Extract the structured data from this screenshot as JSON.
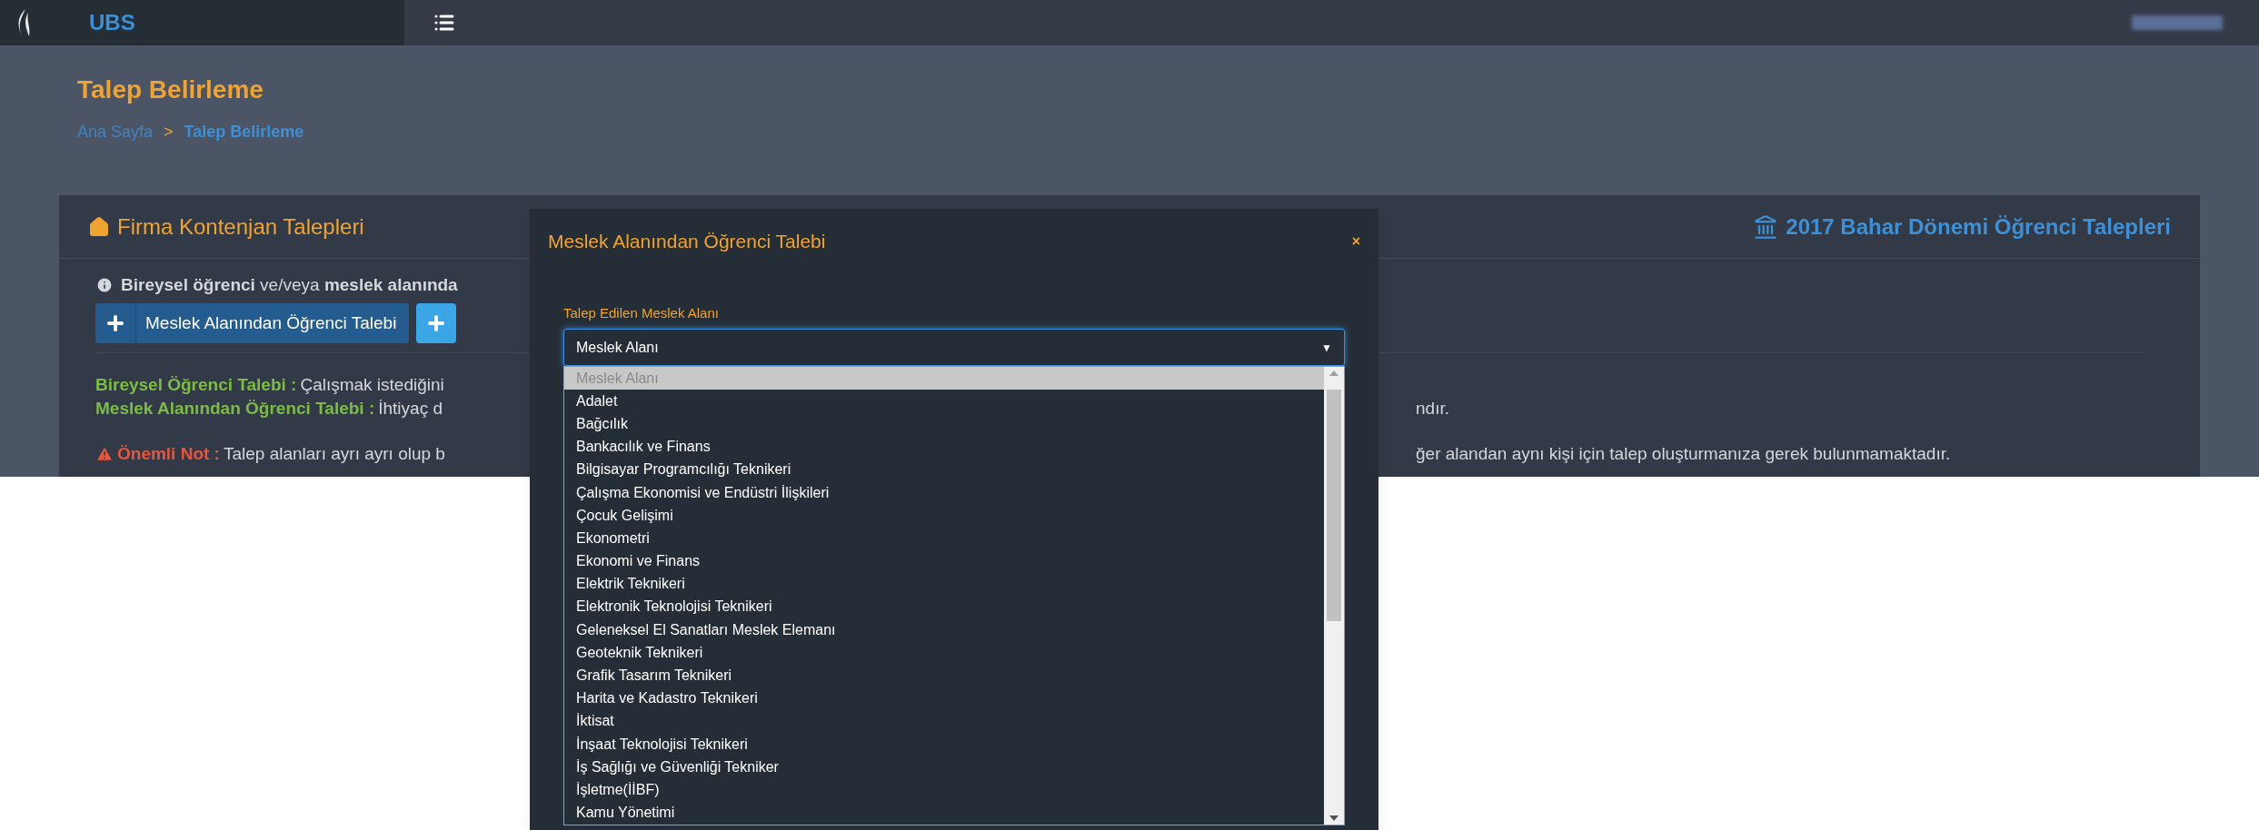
{
  "topbar": {
    "brand": "UBS"
  },
  "header": {
    "title": "Talep Belirleme",
    "breadcrumb_separator": ">",
    "breadcrumb": [
      {
        "label": "Ana Sayfa",
        "current": false
      },
      {
        "label": "Talep Belirleme",
        "current": true
      }
    ]
  },
  "card": {
    "title": "Firma Kontenjan Talepleri",
    "period_title": "2017 Bahar Dönemi Öğrenci Talepleri",
    "info": "**Bireysel öğrenci** ve/veya **meslek alanında**",
    "buttons": [
      {
        "kind": "primary",
        "label": "Meslek Alanından Öğrenci Talebi"
      },
      {
        "kind": "info"
      }
    ],
    "lines": [
      {
        "kind": "definition",
        "term": "Bireysel Öğrenci Talebi :",
        "text_left": "Çalışmak istediğini"
      },
      {
        "kind": "definition",
        "term": "Meslek Alanından Öğrenci Talebi :",
        "text_left": "İhtiyaç d",
        "text_right": "ndır."
      },
      {
        "kind": "warning",
        "term": "Önemli Not :",
        "text_left": "Talep alanları ayrı ayrı olup b",
        "text_right": "ğer alandan aynı kişi için talep oluşturmanıza gerek bulunmamaktadır."
      }
    ]
  },
  "modal": {
    "title": "Meslek Alanından Öğrenci Talebi",
    "close": "×",
    "field": {
      "label": "Talep Edilen Meslek Alanı",
      "value": "Meslek Alanı",
      "arrow": "▼",
      "options": [
        {
          "label": "Meslek Alanı",
          "selected": true
        },
        {
          "label": "Adalet",
          "selected": false
        },
        {
          "label": "Bağcılık",
          "selected": false
        },
        {
          "label": "Bankacılık ve Finans",
          "selected": false
        },
        {
          "label": "Bilgisayar Programcılığı Teknikeri",
          "selected": false
        },
        {
          "label": "Çalışma Ekonomisi ve Endüstri İlişkileri",
          "selected": false
        },
        {
          "label": "Çocuk Gelişimi",
          "selected": false
        },
        {
          "label": "Ekonometri",
          "selected": false
        },
        {
          "label": "Ekonomi ve Finans",
          "selected": false
        },
        {
          "label": "Elektrik Teknikeri",
          "selected": false
        },
        {
          "label": "Elektronik Teknolojisi Teknikeri",
          "selected": false
        },
        {
          "label": "Geleneksel El Sanatları Meslek Elemanı",
          "selected": false
        },
        {
          "label": "Geoteknik Teknikeri",
          "selected": false
        },
        {
          "label": "Grafik Tasarım Teknikeri",
          "selected": false
        },
        {
          "label": "Harita ve Kadastro Teknikeri",
          "selected": false
        },
        {
          "label": "İktisat",
          "selected": false
        },
        {
          "label": "İnşaat Teknolojisi Teknikeri",
          "selected": false
        },
        {
          "label": "İş Sağlığı ve Güvenliği Tekniker",
          "selected": false
        },
        {
          "label": "İşletme(İİBF)",
          "selected": false
        },
        {
          "label": "Kamu Yönetimi",
          "selected": false
        }
      ]
    }
  }
}
